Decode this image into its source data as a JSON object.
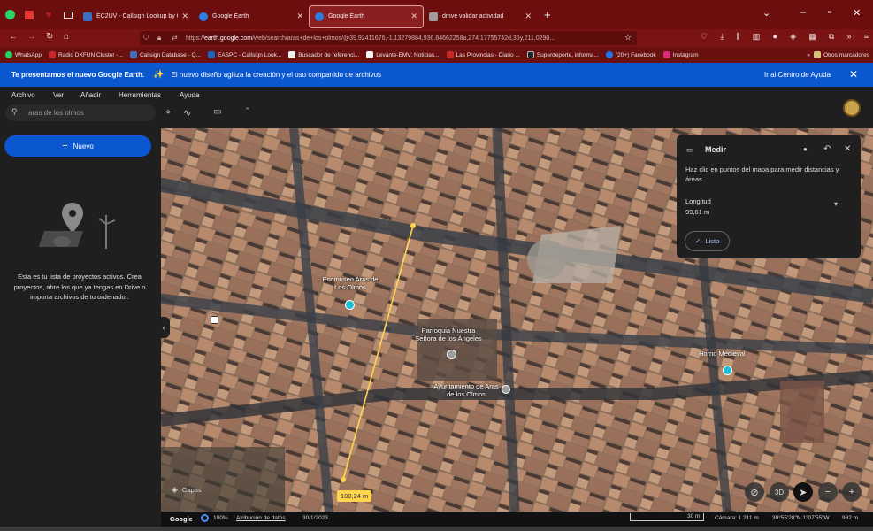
{
  "browser": {
    "pinned_tabs": [
      "whatsapp-icon",
      "app-icon",
      "heart-icon"
    ],
    "tabs": [
      {
        "title": "EC2UV - Callsign Lookup by QR",
        "color": "#3d6fbf"
      },
      {
        "title": "Google Earth",
        "color": "#2f7de1"
      },
      {
        "title": "Google Earth",
        "color": "#2f7de1"
      },
      {
        "title": "dmve validar actividad",
        "color": "#9e9e9e"
      }
    ],
    "url_host": "earth.google.com",
    "url_prefix": "https://",
    "url_rest": "/web/search/aras+de+los+olmos/@39.92411676,-1.13279884,936.84662258a,274.17755742d,35y,211.0290...",
    "bookmarks": [
      {
        "label": "WhatsApp",
        "color": "#25d366"
      },
      {
        "label": "Radio DXFUN Cluster -...",
        "color": "#c62828"
      },
      {
        "label": "Callsign Database - Q...",
        "color": "#3d6fbf"
      },
      {
        "label": "EASPC - Callsign Look...",
        "color": "#1565c0"
      },
      {
        "label": "Buscador de referenci...",
        "color": "#eeeeee"
      },
      {
        "label": "Levante-EMV: Noticias...",
        "color": "#f5f5f5"
      },
      {
        "label": "Las Provincias - Diario ...",
        "color": "#c62828"
      },
      {
        "label": "Superdeporte, informa...",
        "color": "#212121"
      },
      {
        "label": "(20+) Facebook",
        "color": "#1877f2"
      },
      {
        "label": "Instagram",
        "color": "#d62976"
      }
    ],
    "other_bookmarks": "Otros marcadores"
  },
  "banner": {
    "title": "Te presentamos el nuevo Google Earth.",
    "text": "El nuevo diseño agiliza la creación y el uso compartido de archivos",
    "help_link": "Ir al Centro de Ayuda"
  },
  "menu": {
    "items": [
      "Archivo",
      "Ver",
      "Añadir",
      "Herramientas",
      "Ayuda"
    ],
    "search_value": "aras de los olmos"
  },
  "sidebar": {
    "new_button": "Nuevo",
    "empty_text": "Esta es tu lista de proyectos activos. Crea proyectos, abre los que ya tengas en Drive o importa archivos de tu ordenador."
  },
  "map": {
    "labels": [
      {
        "text": "Ecomuseo Aras de Los Olmos"
      },
      {
        "text": "Parroquia Nuestra Señora de los Ángeles"
      },
      {
        "text": "Ayuntamiento de Aras de los Olmos"
      },
      {
        "text": "Horno Medieval"
      }
    ],
    "line_label": "100,24 m",
    "layers_label": "Capas",
    "view_3d": "3D"
  },
  "measure": {
    "title": "Medir",
    "instruction": "Haz clic en puntos del mapa para medir distancias y áreas",
    "length_label": "Longitud",
    "length_value": "99,61 m",
    "done_label": "Listo"
  },
  "status": {
    "brand": "Google",
    "zoom": "100%",
    "attribution": "Atribución de datos",
    "date": "30/1/2023",
    "scale": "30 m",
    "camera": "Cámara: 1.211 m",
    "coords": "39°55'28\"N 1°07'55\"W",
    "elevation": "932 m"
  }
}
